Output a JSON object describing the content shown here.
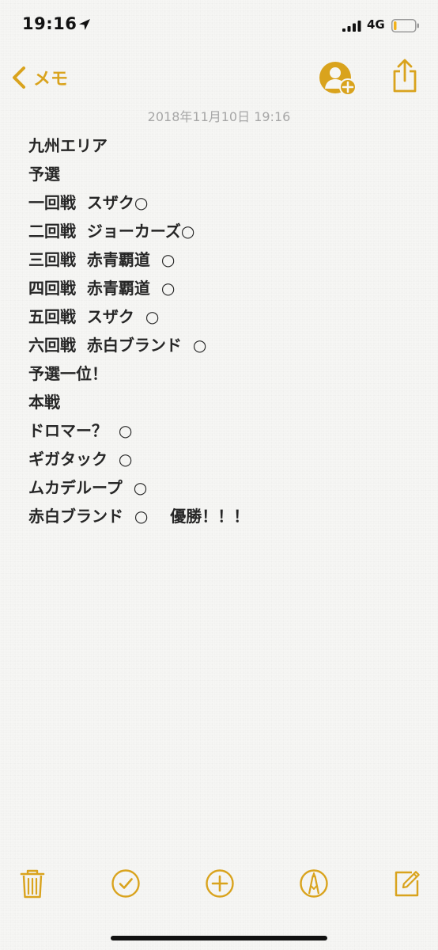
{
  "status_bar": {
    "time": "19:16",
    "network": "4G"
  },
  "nav": {
    "back_label": "メモ"
  },
  "note": {
    "date": "2018年11月10日 19:16",
    "lines": [
      "九州エリア",
      "予選",
      "一回戦  スザク○",
      "二回戦  ジョーカーズ○",
      "三回戦  赤青覇道  ○",
      "四回戦  赤青覇道  ○",
      "五回戦  スザク  ○",
      "六回戦  赤白ブランド  ○",
      "予選一位！",
      "本戦",
      "ドロマー？  ○",
      "ギガタック  ○",
      "ムカデループ  ○",
      "赤白ブランド  ○    優勝！！！"
    ]
  },
  "toolbar": {
    "icons": [
      "trash-icon",
      "checklist-icon",
      "add-icon",
      "markup-icon",
      "compose-icon"
    ]
  },
  "colors": {
    "accent": "#d9a31d",
    "background": "#f6f6f4",
    "text": "#262626",
    "date_text": "#a6a6a6"
  }
}
